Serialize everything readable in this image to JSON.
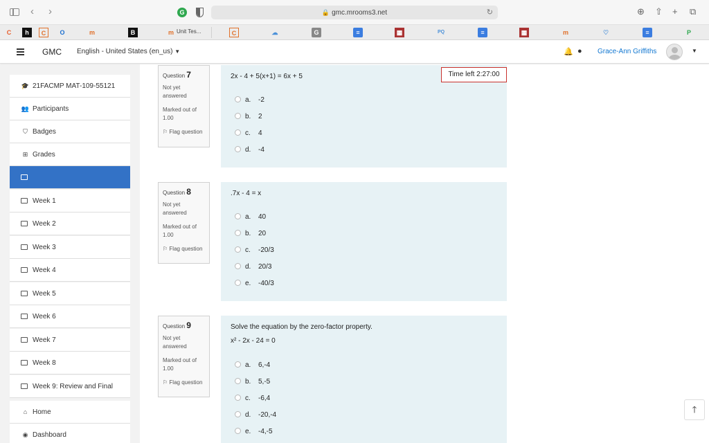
{
  "browser": {
    "url": "gmc.mrooms3.net",
    "g_ext": "G",
    "bookmark_tab_label": "Unit Tes..."
  },
  "navbar": {
    "brand": "GMC",
    "language": "English - United States (en_us)",
    "username": "Grace-Ann Griffiths"
  },
  "drawer": {
    "items": [
      {
        "label": "21FACMP MAT-109-55121",
        "icon": "graduation-cap-icon"
      },
      {
        "label": "Participants",
        "icon": "users-icon"
      },
      {
        "label": "Badges",
        "icon": "shield-icon"
      },
      {
        "label": "Grades",
        "icon": "table-icon"
      },
      {
        "label": "",
        "icon": "folder-icon",
        "active": true
      },
      {
        "label": "Week 1",
        "icon": "folder-icon"
      },
      {
        "label": "Week 2",
        "icon": "folder-icon"
      },
      {
        "label": "Week 3",
        "icon": "folder-icon"
      },
      {
        "label": "Week 4",
        "icon": "folder-icon"
      },
      {
        "label": "Week 5",
        "icon": "folder-icon"
      },
      {
        "label": "Week 6",
        "icon": "folder-icon"
      },
      {
        "label": "Week 7",
        "icon": "folder-icon"
      },
      {
        "label": "Week 8",
        "icon": "folder-icon"
      },
      {
        "label": "Week 9: Review and Final",
        "icon": "folder-icon"
      },
      {
        "label": "Home",
        "icon": "home-icon"
      },
      {
        "label": "Dashboard",
        "icon": "dashboard-icon"
      }
    ]
  },
  "timer": "Time left 2:27:00",
  "questions": [
    {
      "number_prefix": "Question",
      "number": "7",
      "state": "Not yet answered",
      "grade": "Marked out of 1.00",
      "flag": "Flag question",
      "text": "2x - 4 + 5(x+1) = 6x + 5",
      "options": [
        {
          "letter": "a.",
          "text": "-2"
        },
        {
          "letter": "b.",
          "text": "2"
        },
        {
          "letter": "c.",
          "text": "4"
        },
        {
          "letter": "d.",
          "text": "-4"
        }
      ]
    },
    {
      "number_prefix": "Question",
      "number": "8",
      "state": "Not yet answered",
      "grade": "Marked out of 1.00",
      "flag": "Flag question",
      "text": ".7x - 4 = x",
      "options": [
        {
          "letter": "a.",
          "text": "40"
        },
        {
          "letter": "b.",
          "text": "20"
        },
        {
          "letter": "c.",
          "text": "-20/3"
        },
        {
          "letter": "d.",
          "text": "20/3"
        },
        {
          "letter": "e.",
          "text": "-40/3"
        }
      ]
    },
    {
      "number_prefix": "Question",
      "number": "9",
      "state": "Not yet answered",
      "grade": "Marked out of 1.00",
      "flag": "Flag question",
      "text": "Solve the equation by the zero-factor property.",
      "equation": "x² - 2x - 24 = 0",
      "options": [
        {
          "letter": "a.",
          "text": "6,-4"
        },
        {
          "letter": "b.",
          "text": "5,-5"
        },
        {
          "letter": "c.",
          "text": "-6,4"
        },
        {
          "letter": "d.",
          "text": "-20,-4"
        },
        {
          "letter": "e.",
          "text": "-4,-5"
        }
      ]
    }
  ]
}
